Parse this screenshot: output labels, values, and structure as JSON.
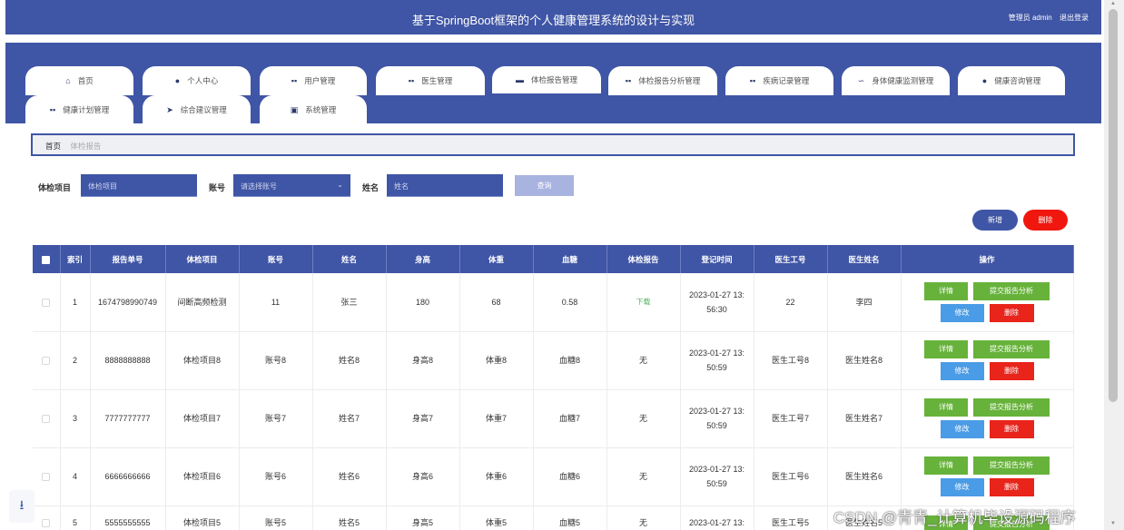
{
  "header": {
    "title": "基于SpringBoot框架的个人健康管理系统的设计与实现",
    "user_label": "管理员 admin",
    "logout_label": "退出登录"
  },
  "nav": {
    "items": [
      {
        "label": "首页",
        "icon": "home-icon",
        "glyph": "⌂"
      },
      {
        "label": "个人中心",
        "icon": "user-icon",
        "glyph": "●"
      },
      {
        "label": "用户管理",
        "icon": "grid-icon",
        "glyph": "▪▪"
      },
      {
        "label": "医生管理",
        "icon": "grid-icon",
        "glyph": "▪▪"
      },
      {
        "label": "体检报告管理",
        "icon": "briefcase-icon",
        "glyph": "▬"
      },
      {
        "label": "体检报告分析管理",
        "icon": "grid-icon",
        "glyph": "▪▪"
      },
      {
        "label": "疾病记录管理",
        "icon": "grid-icon",
        "glyph": "▪▪"
      },
      {
        "label": "身体健康监测管理",
        "icon": "pulse-icon",
        "glyph": "∽"
      },
      {
        "label": "健康咨询管理",
        "icon": "user-icon",
        "glyph": "●"
      },
      {
        "label": "健康计划管理",
        "icon": "grid-icon",
        "glyph": "▪▪"
      },
      {
        "label": "综合建议管理",
        "icon": "send-icon",
        "glyph": "➤"
      },
      {
        "label": "系统管理",
        "icon": "clipboard-icon",
        "glyph": "▣"
      }
    ],
    "active_index": 4
  },
  "breadcrumb": {
    "home": "首页",
    "current": "体检报告"
  },
  "search": {
    "item_label": "体检项目",
    "item_placeholder": "体检项目",
    "account_label": "账号",
    "account_placeholder": "请选择账号",
    "name_label": "姓名",
    "name_placeholder": "姓名",
    "button_label": "查询"
  },
  "actions": {
    "add_label": "新增",
    "delete_label": "删除"
  },
  "table": {
    "columns": [
      "索引",
      "报告单号",
      "体检项目",
      "账号",
      "姓名",
      "身高",
      "体重",
      "血糖",
      "体检报告",
      "登记时间",
      "医生工号",
      "医生姓名",
      "操作"
    ],
    "rows": [
      {
        "index": "1",
        "report_no": "1674798990749",
        "item": "间断高频检测",
        "account": "11",
        "name": "张三",
        "height": "180",
        "weight": "68",
        "blood_sugar": "0.58",
        "report": "下载",
        "time_a": "2023-01-27 13:",
        "time_b": "56:30",
        "doctor_no": "22",
        "doctor_name": "李四"
      },
      {
        "index": "2",
        "report_no": "8888888888",
        "item": "体检项目8",
        "account": "账号8",
        "name": "姓名8",
        "height": "身高8",
        "weight": "体重8",
        "blood_sugar": "血糖8",
        "report": "无",
        "time_a": "2023-01-27 13:",
        "time_b": "50:59",
        "doctor_no": "医生工号8",
        "doctor_name": "医生姓名8"
      },
      {
        "index": "3",
        "report_no": "7777777777",
        "item": "体检项目7",
        "account": "账号7",
        "name": "姓名7",
        "height": "身高7",
        "weight": "体重7",
        "blood_sugar": "血糖7",
        "report": "无",
        "time_a": "2023-01-27 13:",
        "time_b": "50:59",
        "doctor_no": "医生工号7",
        "doctor_name": "医生姓名7"
      },
      {
        "index": "4",
        "report_no": "6666666666",
        "item": "体检项目6",
        "account": "账号6",
        "name": "姓名6",
        "height": "身高6",
        "weight": "体重6",
        "blood_sugar": "血糖6",
        "report": "无",
        "time_a": "2023-01-27 13:",
        "time_b": "50:59",
        "doctor_no": "医生工号6",
        "doctor_name": "医生姓名6"
      },
      {
        "index": "5",
        "report_no": "5555555555",
        "item": "体检项目5",
        "account": "账号5",
        "name": "姓名5",
        "height": "身高5",
        "weight": "体重5",
        "blood_sugar": "血糖5",
        "report": "无",
        "time_a": "2023-01-27 13:",
        "time_b": "",
        "doctor_no": "医生工号5",
        "doctor_name": "医生姓名5"
      }
    ],
    "row_actions": {
      "detail": "详情",
      "submit": "提交报告分析",
      "edit": "修改",
      "delete": "删除"
    }
  },
  "watermark": "CSDN @青青_计算机毕设源码程序",
  "colors": {
    "primary": "#3f55a5",
    "green": "#67b23b",
    "blue": "#4b9ce6",
    "red": "#e8241b"
  }
}
